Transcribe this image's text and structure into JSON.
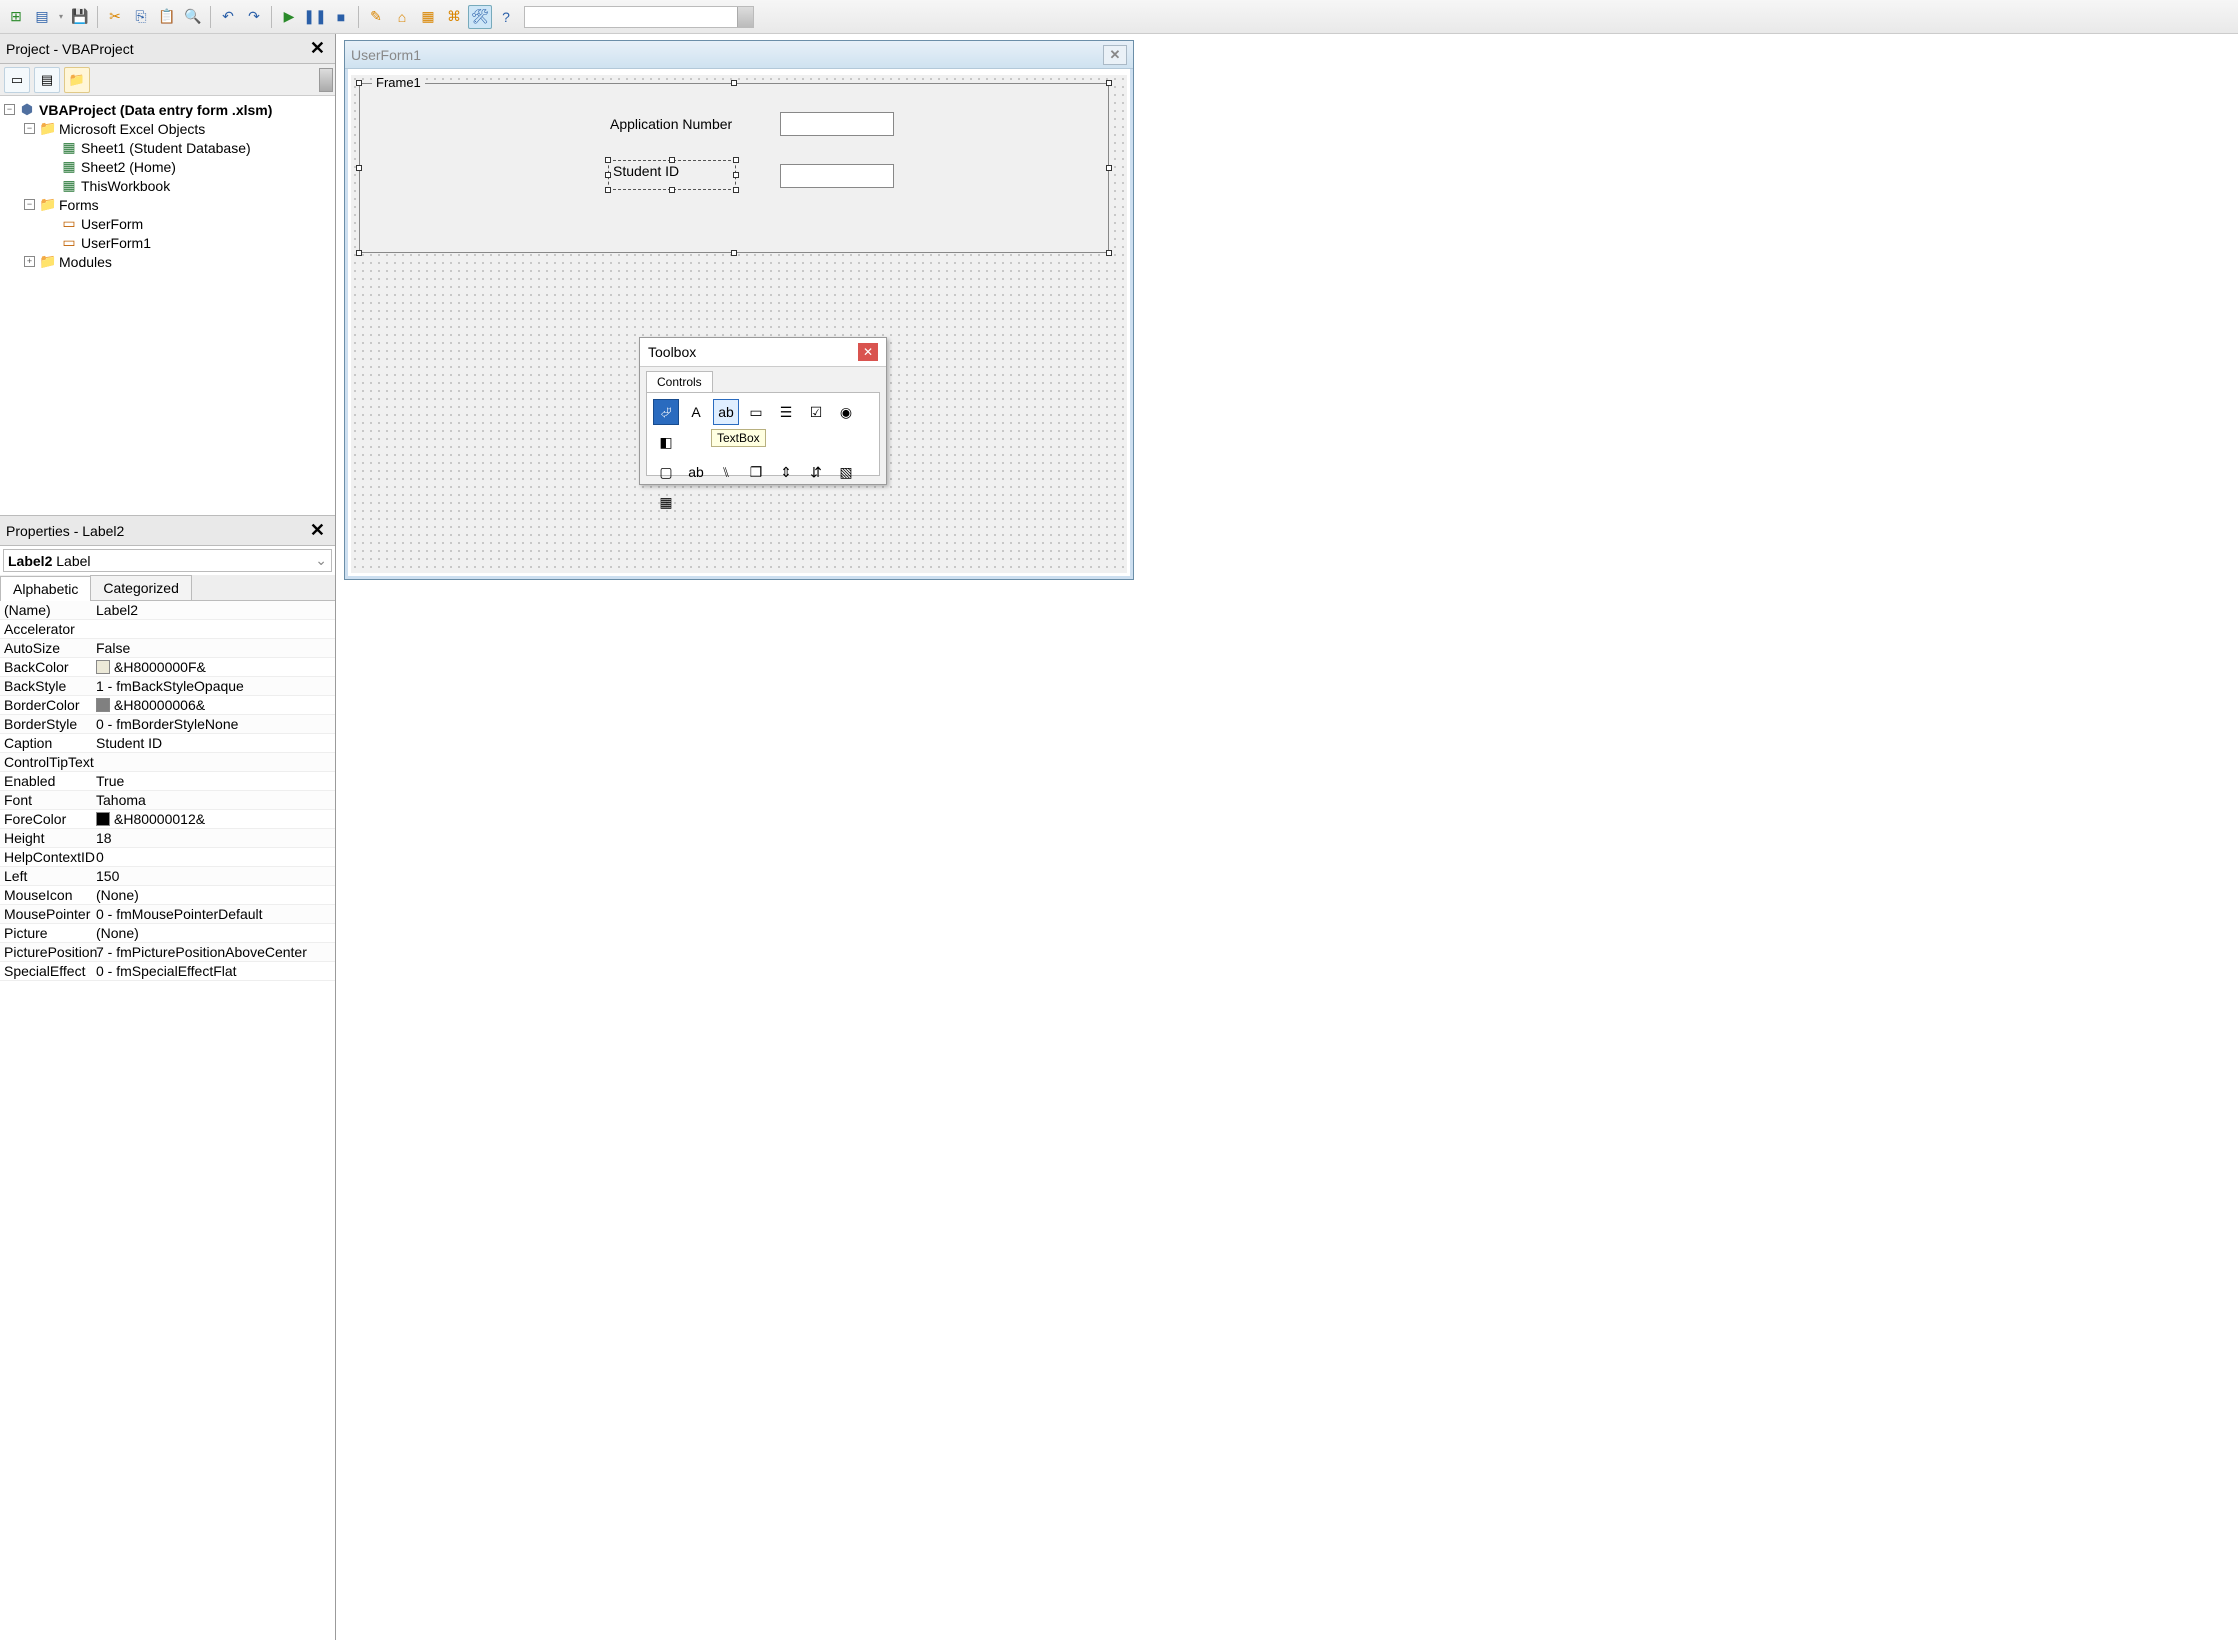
{
  "toolbar": {
    "items": [
      {
        "name": "excel-icon",
        "glyph": "⊞",
        "cls": "green"
      },
      {
        "name": "insert-icon",
        "glyph": "▤",
        "cls": "blue"
      },
      {
        "name": "dropdown-icon",
        "glyph": "▾",
        "cls": "gray",
        "narrow": true
      },
      {
        "name": "save-icon",
        "glyph": "💾",
        "cls": "blue"
      },
      {
        "sep": true
      },
      {
        "name": "cut-icon",
        "glyph": "✂",
        "cls": "orange"
      },
      {
        "name": "copy-icon",
        "glyph": "⎘",
        "cls": "blue"
      },
      {
        "name": "paste-icon",
        "glyph": "📋",
        "cls": "gray"
      },
      {
        "name": "find-icon",
        "glyph": "🔍",
        "cls": "gray"
      },
      {
        "sep": true
      },
      {
        "name": "undo-icon",
        "glyph": "↶",
        "cls": "blue"
      },
      {
        "name": "redo-icon",
        "glyph": "↷",
        "cls": "blue"
      },
      {
        "sep": true
      },
      {
        "name": "run-icon",
        "glyph": "▶",
        "cls": "green"
      },
      {
        "name": "pause-icon",
        "glyph": "❚❚",
        "cls": "blue"
      },
      {
        "name": "stop-icon",
        "glyph": "■",
        "cls": "blue"
      },
      {
        "sep": true
      },
      {
        "name": "design-icon",
        "glyph": "✎",
        "cls": "orange"
      },
      {
        "name": "project-explorer-icon",
        "glyph": "⌂",
        "cls": "orange"
      },
      {
        "name": "properties-icon",
        "glyph": "▦",
        "cls": "orange"
      },
      {
        "name": "object-browser-icon",
        "glyph": "⌘",
        "cls": "orange"
      },
      {
        "name": "toolbox-icon",
        "glyph": "🛠",
        "cls": "blue",
        "active": true
      },
      {
        "name": "help-icon",
        "glyph": "?",
        "cls": "blue"
      }
    ]
  },
  "project_panel": {
    "title": "Project - VBAProject",
    "root": "VBAProject (Data entry form .xlsm)",
    "groups": [
      {
        "label": "Microsoft Excel Objects",
        "items": [
          {
            "label": "Sheet1 (Student Database)",
            "icon": "sheet"
          },
          {
            "label": "Sheet2 (Home)",
            "icon": "sheet"
          },
          {
            "label": "ThisWorkbook",
            "icon": "sheet"
          }
        ]
      },
      {
        "label": "Forms",
        "items": [
          {
            "label": "UserForm",
            "icon": "form"
          },
          {
            "label": "UserForm1",
            "icon": "form"
          }
        ]
      },
      {
        "label": "Modules",
        "collapsed": true,
        "items": []
      }
    ]
  },
  "properties_panel": {
    "title": "Properties - Label2",
    "object_name": "Label2",
    "object_type": "Label",
    "tabs": [
      "Alphabetic",
      "Categorized"
    ],
    "active_tab": "Alphabetic",
    "rows": [
      {
        "name": "(Name)",
        "value": "Label2"
      },
      {
        "name": "Accelerator",
        "value": ""
      },
      {
        "name": "AutoSize",
        "value": "False"
      },
      {
        "name": "BackColor",
        "value": "&H8000000F&",
        "swatch": "#ece9d8"
      },
      {
        "name": "BackStyle",
        "value": "1 - fmBackStyleOpaque"
      },
      {
        "name": "BorderColor",
        "value": "&H80000006&",
        "swatch": "#808080"
      },
      {
        "name": "BorderStyle",
        "value": "0 - fmBorderStyleNone"
      },
      {
        "name": "Caption",
        "value": "Student ID"
      },
      {
        "name": "ControlTipText",
        "value": ""
      },
      {
        "name": "Enabled",
        "value": "True"
      },
      {
        "name": "Font",
        "value": "Tahoma"
      },
      {
        "name": "ForeColor",
        "value": "&H80000012&",
        "swatch": "#000000"
      },
      {
        "name": "Height",
        "value": "18"
      },
      {
        "name": "HelpContextID",
        "value": "0"
      },
      {
        "name": "Left",
        "value": "150"
      },
      {
        "name": "MouseIcon",
        "value": "(None)"
      },
      {
        "name": "MousePointer",
        "value": "0 - fmMousePointerDefault"
      },
      {
        "name": "Picture",
        "value": "(None)"
      },
      {
        "name": "PicturePosition",
        "value": "7 - fmPicturePositionAboveCenter"
      },
      {
        "name": "SpecialEffect",
        "value": "0 - fmSpecialEffectFlat"
      }
    ]
  },
  "designer": {
    "form_title": "UserForm1",
    "frame_caption": "Frame1",
    "label1": "Application Number",
    "label2": "Student ID"
  },
  "toolbox": {
    "title": "Toolbox",
    "tab": "Controls",
    "tooltip": "TextBox",
    "row1": [
      {
        "name": "select-tool",
        "glyph": "⮰",
        "sel": true
      },
      {
        "name": "label-tool",
        "glyph": "A"
      },
      {
        "name": "textbox-tool",
        "glyph": "ab",
        "hl": true
      },
      {
        "name": "combobox-tool",
        "glyph": "▭"
      },
      {
        "name": "listbox-tool",
        "glyph": "☰"
      },
      {
        "name": "checkbox-tool",
        "glyph": "☑"
      },
      {
        "name": "optionbutton-tool",
        "glyph": "◉"
      },
      {
        "name": "togglebutton-tool",
        "glyph": "◧"
      }
    ],
    "row2": [
      {
        "name": "frame-tool",
        "glyph": "▢"
      },
      {
        "name": "commandbutton-tool",
        "glyph": "ab"
      },
      {
        "name": "tabstrip-tool",
        "glyph": "⑊"
      },
      {
        "name": "multipage-tool",
        "glyph": "❐"
      },
      {
        "name": "scrollbar-tool",
        "glyph": "⇕"
      },
      {
        "name": "spinbutton-tool",
        "glyph": "⇵"
      },
      {
        "name": "image-tool",
        "glyph": "▧"
      },
      {
        "name": "refedit-tool",
        "glyph": "▦"
      }
    ]
  }
}
